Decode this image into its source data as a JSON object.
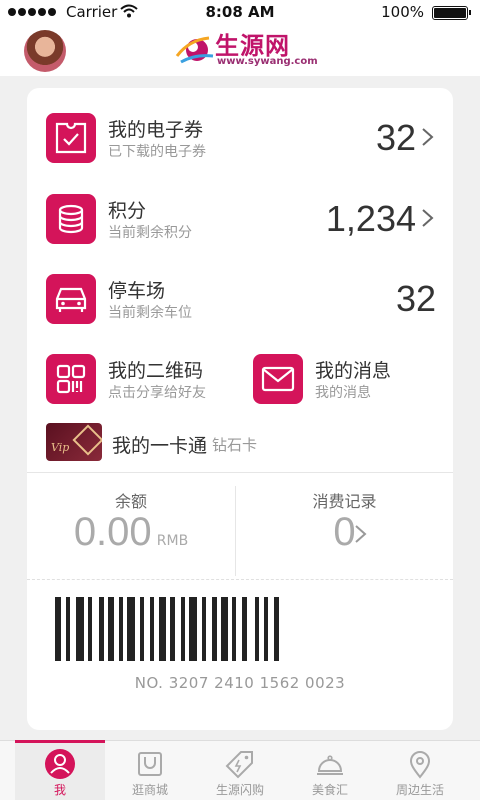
{
  "status_bar": {
    "carrier": "Carrier",
    "time": "8:08 AM",
    "battery": "100%"
  },
  "header": {
    "logo_text": "生源网",
    "logo_sub": "www.sywang.com"
  },
  "rows": {
    "coupons": {
      "title": "我的电子券",
      "subtitle": "已下载的电子券",
      "value": "32",
      "icon": "ticket-check-icon"
    },
    "points": {
      "title": "积分",
      "subtitle": "当前剩余积分",
      "value": "1,234",
      "icon": "coin-stack-icon"
    },
    "parking": {
      "title": "停车场",
      "subtitle": "当前剩余车位",
      "value": "32",
      "icon": "car-icon"
    }
  },
  "qr": {
    "title": "我的二维码",
    "subtitle": "点击分享给好友",
    "icon": "qrcode-icon"
  },
  "messages": {
    "title": "我的消息",
    "subtitle": "我的消息",
    "icon": "envelope-icon"
  },
  "member_card": {
    "title": "我的一卡通",
    "type": "钻石卡",
    "card_text": "Vip"
  },
  "balance": {
    "label": "余额",
    "value": "0.00",
    "unit": "RMB"
  },
  "records": {
    "label": "消费记录",
    "value": "0"
  },
  "barcode": {
    "number": "NO. 3207  2410 1562  0023"
  },
  "tabs": [
    {
      "label": "我",
      "icon": "user-icon",
      "active": true
    },
    {
      "label": "逛商城",
      "icon": "bag-icon",
      "active": false
    },
    {
      "label": "生源闪购",
      "icon": "tag-icon",
      "active": false
    },
    {
      "label": "美食汇",
      "icon": "cloche-icon",
      "active": false
    },
    {
      "label": "周边生活",
      "icon": "location-pin-icon",
      "active": false
    }
  ],
  "colors": {
    "accent": "#d4145a",
    "background": "#f0f0f0"
  }
}
